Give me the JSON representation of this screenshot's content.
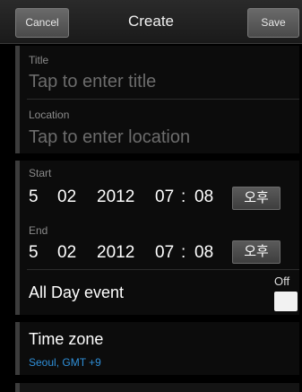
{
  "header": {
    "cancel_label": "Cancel",
    "title": "Create",
    "save_label": "Save"
  },
  "title_field": {
    "label": "Title",
    "placeholder": "Tap to enter title"
  },
  "location_field": {
    "label": "Location",
    "placeholder": "Tap to enter location"
  },
  "start": {
    "label": "Start",
    "month": "5",
    "day": "02",
    "year": "2012",
    "hour": "07",
    "separator": ":",
    "minute": "08",
    "ampm": "오후"
  },
  "end": {
    "label": "End",
    "month": "5",
    "day": "02",
    "year": "2012",
    "hour": "07",
    "separator": ":",
    "minute": "08",
    "ampm": "오후"
  },
  "all_day": {
    "label": "All Day event",
    "state_label": "Off"
  },
  "timezone": {
    "label": "Time zone",
    "value": "Seoul, GMT +9"
  },
  "colors": {
    "accent": "#2f8fd8",
    "background": "#000000"
  }
}
